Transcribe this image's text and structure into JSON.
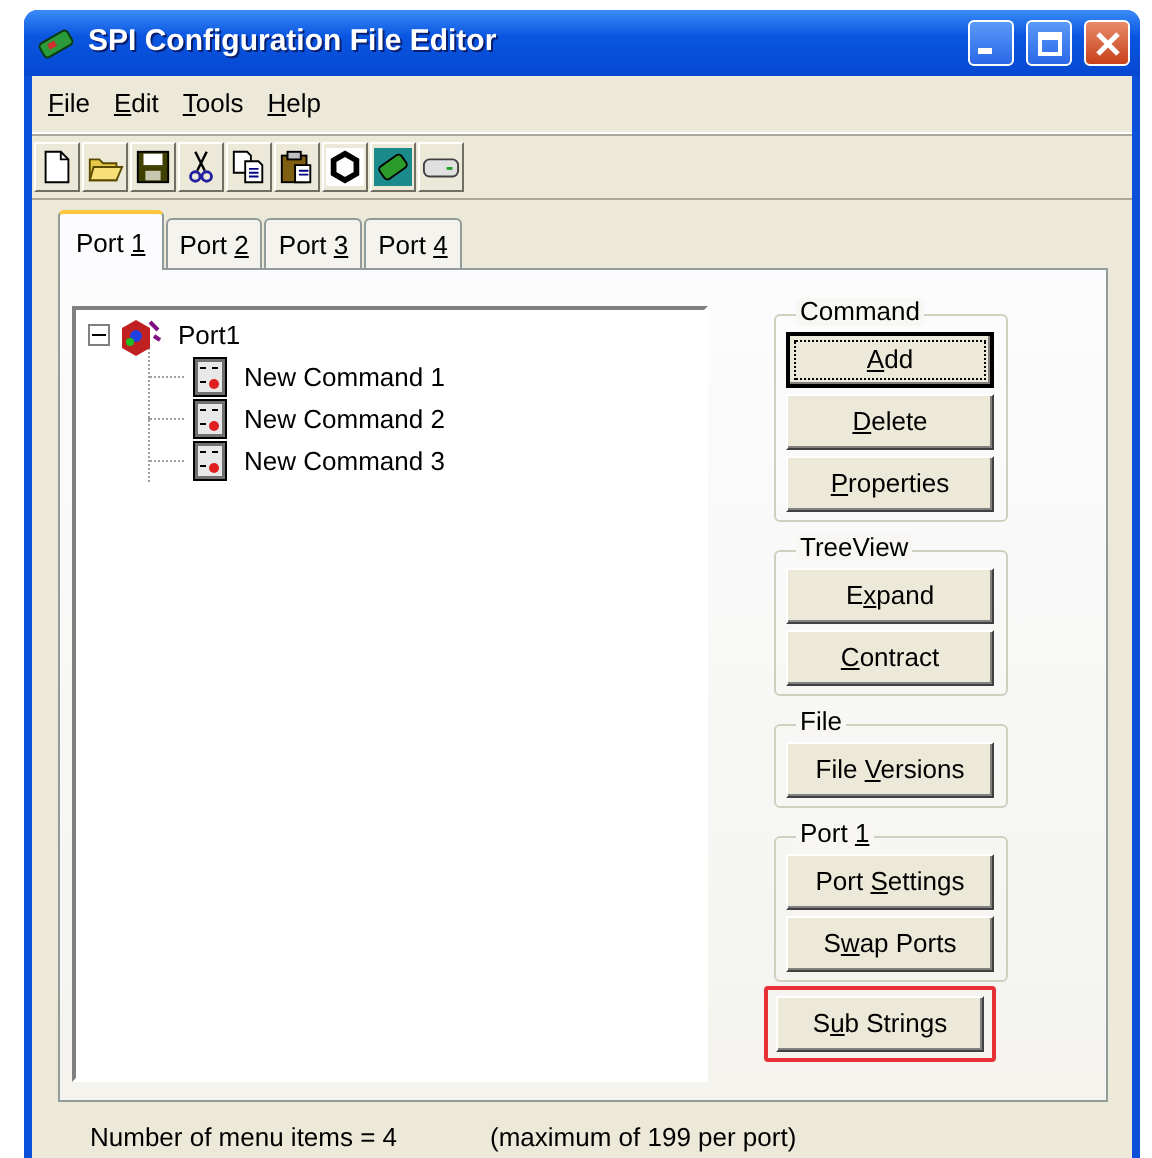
{
  "window": {
    "title": "SPI Configuration File Editor"
  },
  "menu": [
    {
      "key": "F",
      "post": "ile"
    },
    {
      "key": "E",
      "post": "dit"
    },
    {
      "key": "T",
      "post": "ools"
    },
    {
      "key": "H",
      "post": "elp"
    }
  ],
  "toolbar": [
    {
      "kind": "new"
    },
    {
      "kind": "open"
    },
    {
      "kind": "save"
    },
    {
      "kind": "cut"
    },
    {
      "kind": "copy"
    },
    {
      "kind": "paste"
    },
    {
      "kind": "hexagon"
    },
    {
      "kind": "board"
    },
    {
      "kind": "drive"
    }
  ],
  "tabs": [
    {
      "pre": "Port ",
      "key": "1",
      "selected": true
    },
    {
      "pre": "Port ",
      "key": "2",
      "selected": false
    },
    {
      "pre": "Port ",
      "key": "3",
      "selected": false
    },
    {
      "pre": "Port ",
      "key": "4",
      "selected": false
    }
  ],
  "tree": [
    {
      "label": "Port1",
      "expanded": true,
      "children": [
        {
          "label": "New Command 1"
        },
        {
          "label": "New Command 2"
        },
        {
          "label": "New Command 3"
        }
      ]
    }
  ],
  "groups": [
    {
      "title_pre": "Command",
      "buttons": [
        {
          "key": "A",
          "post": "dd",
          "focused": true
        },
        {
          "key": "D",
          "post": "elete"
        },
        {
          "key": "P",
          "post": "roperties"
        }
      ]
    },
    {
      "title_pre": "TreeView",
      "buttons": [
        {
          "pre": "E",
          "key": "x",
          "post": "pand"
        },
        {
          "key": "C",
          "post": "ontract"
        }
      ]
    },
    {
      "title_pre": "File",
      "buttons": [
        {
          "pre": "File ",
          "key": "V",
          "post": "ersions"
        }
      ]
    },
    {
      "title_pre": "Port ",
      "title_key": "1",
      "buttons": [
        {
          "pre": "Port ",
          "key": "S",
          "post": "ettings"
        },
        {
          "pre": "S",
          "key": "w",
          "post": "ap Ports"
        }
      ]
    }
  ],
  "extra_button": {
    "pre": "S",
    "key": "u",
    "post": "b Strings",
    "highlighted": true
  },
  "status": [
    "Number of menu items = 4",
    "(maximum of 199 per port)"
  ]
}
